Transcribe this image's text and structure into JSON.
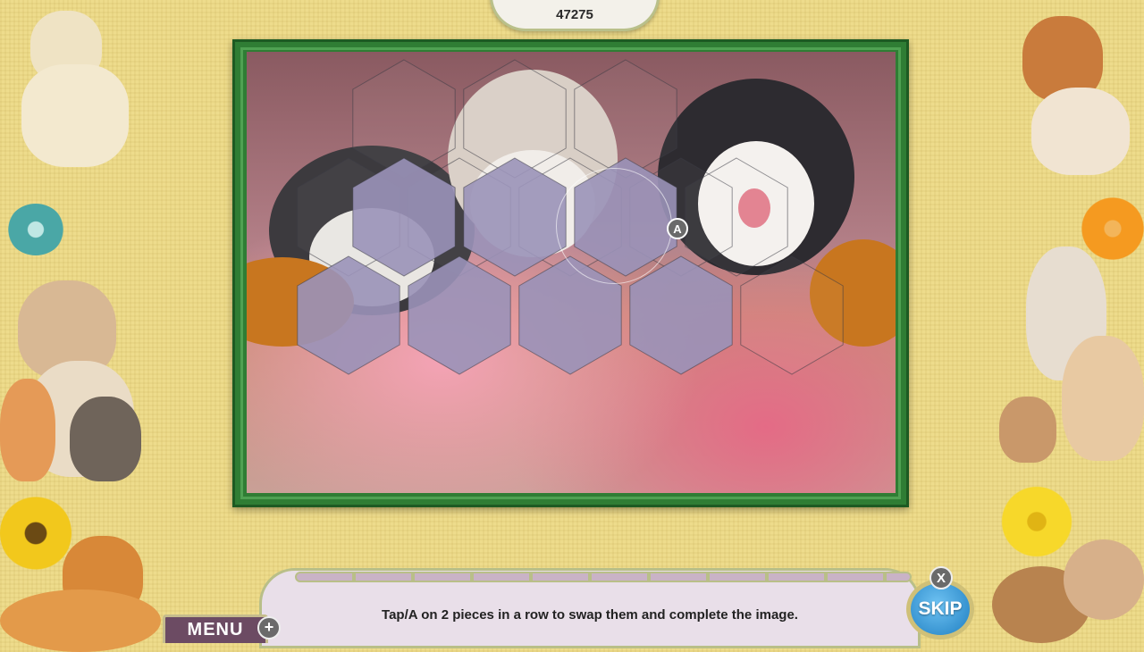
{
  "score": "47275",
  "hint": "Tap/A on 2 pieces in a row to swap them and complete the image.",
  "menu_label": "MENU",
  "plus_glyph": "+",
  "skip_label": "SKIP",
  "x_glyph": "X",
  "a_glyph": "A",
  "colors": {
    "board_frame": "#2f7d34",
    "tinted_piece": "#9a92b8",
    "skip_button": "#2f93d6",
    "menu_button": "#6c4b63"
  },
  "decorations": [
    "puppy-picture",
    "flower-icon",
    "bulldog-and-kittens-picture",
    "sunflower-icon",
    "spaniel-picture",
    "corgi-picture",
    "flower-icon",
    "rabbit-kitten-hamster-picture",
    "sunflower-icon",
    "guinea-pigs-picture"
  ]
}
